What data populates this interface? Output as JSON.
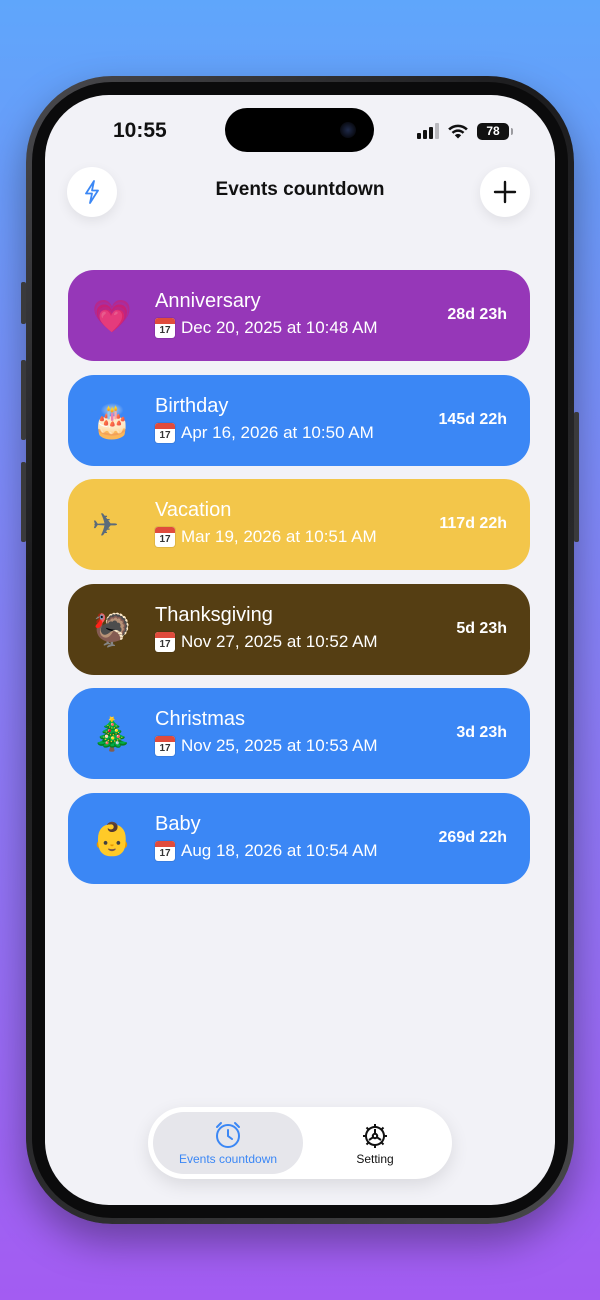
{
  "status_bar": {
    "time": "10:55",
    "battery": "78"
  },
  "header": {
    "title": "Events countdown"
  },
  "events": [
    {
      "emoji": "💗",
      "name": "Anniversary",
      "date": "Dec 20, 2025 at 10:48 AM",
      "countdown": "28d 23h",
      "color": "#9637b8"
    },
    {
      "emoji": "🎂",
      "name": "Birthday",
      "date": "Apr 16, 2026 at 10:50 AM",
      "countdown": "145d 22h",
      "color": "#3b87f5"
    },
    {
      "emoji": "✈",
      "name": "Vacation",
      "date": "Mar 19, 2026 at 10:51 AM",
      "countdown": "117d 22h",
      "color": "#f3c64a"
    },
    {
      "emoji": "🦃",
      "name": "Thanksgiving",
      "date": "Nov 27, 2025 at 10:52 AM",
      "countdown": "5d 23h",
      "color": "#553e13"
    },
    {
      "emoji": "🎄",
      "name": "Christmas",
      "date": "Nov 25, 2025 at 10:53 AM",
      "countdown": "3d 23h",
      "color": "#3b87f5"
    },
    {
      "emoji": "👶",
      "name": "Baby",
      "date": "Aug 18, 2026 at 10:54 AM",
      "countdown": "269d 22h",
      "color": "#3b87f5"
    }
  ],
  "calendar_icon_day": "17",
  "tabs": [
    {
      "label": "Events countdown",
      "icon": "alarm-clock-icon",
      "active": true
    },
    {
      "label": "Setting",
      "icon": "gear-icon",
      "active": false
    }
  ],
  "colors": {
    "accent": "#3b87f5",
    "background": "#f2f2f7",
    "anniversary": "#9637b8",
    "vacation": "#f3c64a",
    "thanksgiving": "#553e13"
  }
}
